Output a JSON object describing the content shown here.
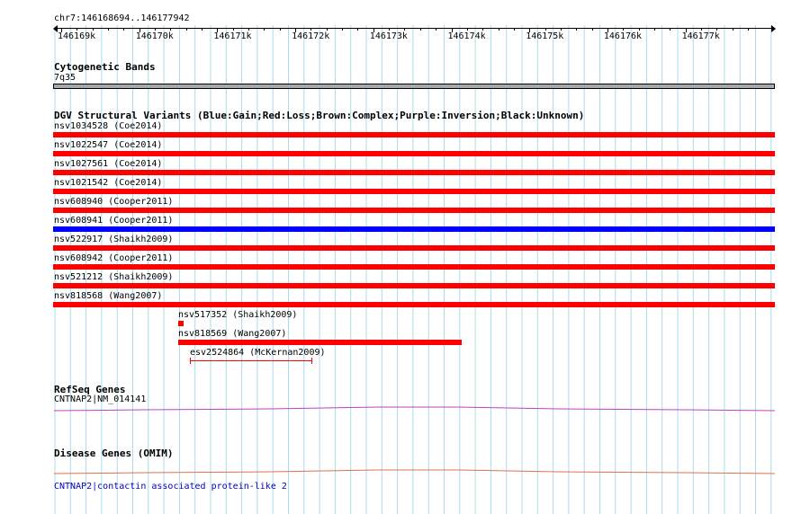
{
  "ruler": {
    "location": "chr7:146168694..146177942",
    "ticks": [
      "146169k",
      "146170k",
      "146171k",
      "146172k",
      "146173k",
      "146174k",
      "146175k",
      "146176k",
      "146177k"
    ]
  },
  "cytoband": {
    "title": "Cytogenetic Bands",
    "band": "7q35"
  },
  "dgv": {
    "title": "DGV Structural Variants (Blue:Gain;Red:Loss;Brown:Complex;Purple:Inversion;Black:Unknown)",
    "colors": {
      "loss": "#ff0000",
      "gain": "#0000ff"
    },
    "full_rows": [
      {
        "label": "nsv1034528 (Coe2014)",
        "type": "loss"
      },
      {
        "label": "nsv1022547 (Coe2014)",
        "type": "loss"
      },
      {
        "label": "nsv1027561 (Coe2014)",
        "type": "loss"
      },
      {
        "label": "nsv1021542 (Coe2014)",
        "type": "loss"
      },
      {
        "label": "nsv608940 (Cooper2011)",
        "type": "loss"
      },
      {
        "label": "nsv608941 (Cooper2011)",
        "type": "gain"
      },
      {
        "label": "nsv522917 (Shaikh2009)",
        "type": "loss"
      },
      {
        "label": "nsv608942 (Cooper2011)",
        "type": "loss"
      },
      {
        "label": "nsv521212 (Shaikh2009)",
        "type": "loss"
      },
      {
        "label": "nsv818568 (Wang2007)",
        "type": "loss"
      }
    ],
    "partial": {
      "nsv517352": "nsv517352 (Shaikh2009)",
      "nsv818569": "nsv818569 (Wang2007)",
      "esv2524864": "esv2524864 (McKernan2009)"
    }
  },
  "refseq": {
    "title": "RefSeq Genes",
    "gene": "CNTNAP2|NM_014141",
    "color": "#c040c0"
  },
  "omim": {
    "title": "Disease Genes (OMIM)",
    "gene": "CNTNAP2|contactin associated protein-like 2",
    "color": "#e07050",
    "link_color": "#0000c0"
  }
}
